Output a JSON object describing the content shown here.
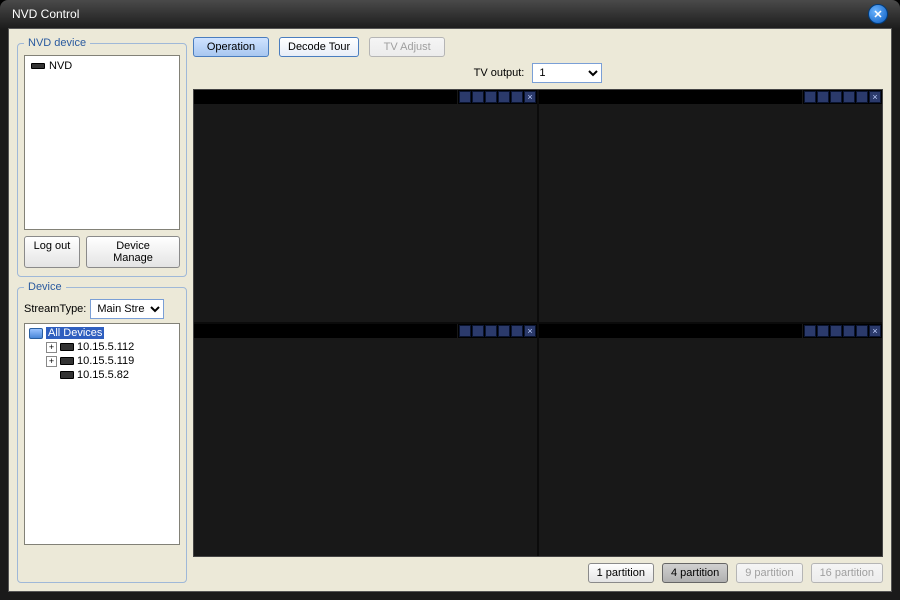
{
  "window": {
    "title": "NVD Control"
  },
  "left": {
    "nvd_legend": "NVD device",
    "nvd_items": [
      {
        "label": "NVD"
      }
    ],
    "logout_label": "Log out",
    "device_manage_label": "Device Manage",
    "device_legend": "Device",
    "stream_label": "StreamType:",
    "stream_options": [
      "Main Stream"
    ],
    "stream_selected": "Main Stream",
    "tree": {
      "root_label": "All Devices",
      "children": [
        {
          "expandable": true,
          "label": "10.15.5.112"
        },
        {
          "expandable": true,
          "label": "10.15.5.119"
        },
        {
          "expandable": false,
          "label": "10.15.5.82"
        }
      ]
    }
  },
  "top": {
    "operation_label": "Operation",
    "decode_tour_label": "Decode Tour",
    "tv_adjust_label": "TV Adjust",
    "tv_output_label": "TV output:",
    "tv_output_options": [
      "1"
    ],
    "tv_output_selected": "1"
  },
  "partition": {
    "p1": "1 partition",
    "p4": "4 partition",
    "p9": "9 partition",
    "p16": "16 partition"
  }
}
